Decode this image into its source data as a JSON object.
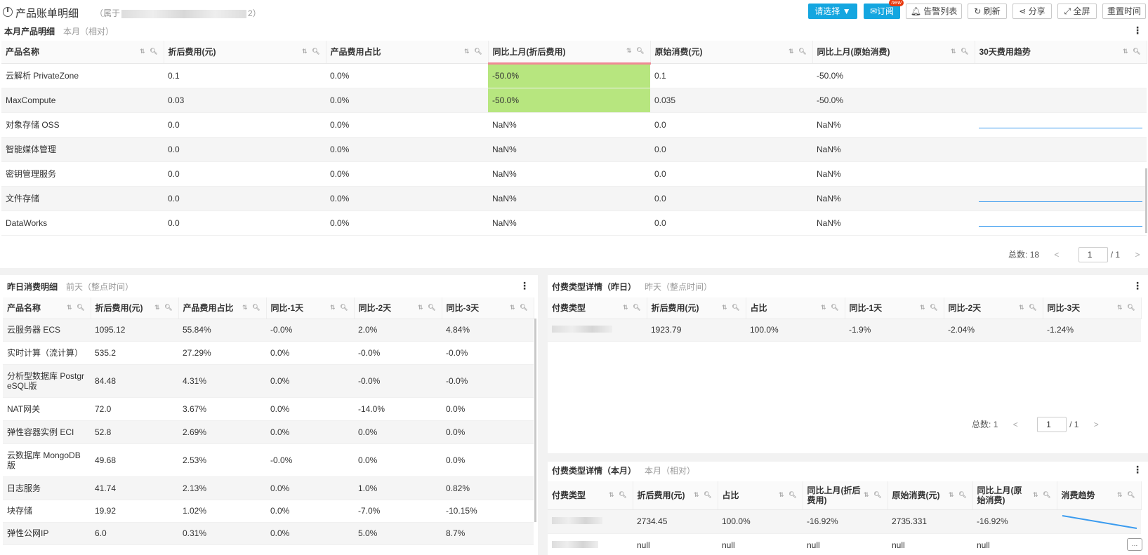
{
  "header": {
    "title": "产品账单明细",
    "owner_prefix": "（属于",
    "owner_suffix": "2）",
    "buttons": {
      "select": "请选择",
      "subscribe": "订阅",
      "new_badge": "new",
      "alerts": "告警列表",
      "refresh": "刷新",
      "share": "分享",
      "fullscreen": "全屏",
      "reset_time": "重置时间"
    }
  },
  "monthly": {
    "title": "本月产品明细",
    "subtitle": "本月（相对）",
    "columns": [
      "产品名称",
      "折后费用(元)",
      "产品费用占比",
      "同比上月(折后费用)",
      "原始消费(元)",
      "同比上月(原始消费)",
      "30天费用趋势"
    ],
    "rows": [
      {
        "name": "云解析 PrivateZone",
        "cost": "0.1",
        "share": "0.0%",
        "mom": "-50.0%",
        "raw": "0.1",
        "raw_mom": "-50.0%",
        "trend": false
      },
      {
        "name": "MaxCompute",
        "cost": "0.03",
        "share": "0.0%",
        "mom": "-50.0%",
        "raw": "0.035",
        "raw_mom": "-50.0%",
        "trend": false
      },
      {
        "name": "对象存储 OSS",
        "cost": "0.0",
        "share": "0.0%",
        "mom": "NaN%",
        "raw": "0.0",
        "raw_mom": "NaN%",
        "trend": true
      },
      {
        "name": "智能媒体管理",
        "cost": "0.0",
        "share": "0.0%",
        "mom": "NaN%",
        "raw": "0.0",
        "raw_mom": "NaN%",
        "trend": false
      },
      {
        "name": "密钥管理服务",
        "cost": "0.0",
        "share": "0.0%",
        "mom": "NaN%",
        "raw": "0.0",
        "raw_mom": "NaN%",
        "trend": false
      },
      {
        "name": "文件存储",
        "cost": "0.0",
        "share": "0.0%",
        "mom": "NaN%",
        "raw": "0.0",
        "raw_mom": "NaN%",
        "trend": true
      },
      {
        "name": "DataWorks",
        "cost": "0.0",
        "share": "0.0%",
        "mom": "NaN%",
        "raw": "0.0",
        "raw_mom": "NaN%",
        "trend": true
      }
    ],
    "pager": {
      "total_label": "总数:",
      "total": "18",
      "page": "1",
      "of": "/ 1",
      "prev": "<",
      "next": ">"
    }
  },
  "yesterday": {
    "title": "昨日消费明细",
    "subtitle": "前天（整点时间）",
    "columns": [
      "产品名称",
      "折后费用(元)",
      "产品费用占比",
      "同比-1天",
      "同比-2天",
      "同比-3天"
    ],
    "rows": [
      {
        "name": "云服务器 ECS",
        "cost": "1095.12",
        "share": "55.84%",
        "d1": "-0.0%",
        "d2": "2.0%",
        "d3": "4.84%"
      },
      {
        "name": "实时计算（流计算）",
        "cost": "535.2",
        "share": "27.29%",
        "d1": "0.0%",
        "d2": "-0.0%",
        "d3": "-0.0%"
      },
      {
        "name": "分析型数据库 PostgreSQL版",
        "cost": "84.48",
        "share": "4.31%",
        "d1": "0.0%",
        "d2": "-0.0%",
        "d3": "-0.0%"
      },
      {
        "name": "NAT网关",
        "cost": "72.0",
        "share": "3.67%",
        "d1": "0.0%",
        "d2": "-14.0%",
        "d3": "0.0%"
      },
      {
        "name": "弹性容器实例 ECI",
        "cost": "52.8",
        "share": "2.69%",
        "d1": "0.0%",
        "d2": "0.0%",
        "d3": "0.0%"
      },
      {
        "name": "云数据库 MongoDB版",
        "cost": "49.68",
        "share": "2.53%",
        "d1": "-0.0%",
        "d2": "0.0%",
        "d3": "0.0%"
      },
      {
        "name": "日志服务",
        "cost": "41.74",
        "share": "2.13%",
        "d1": "0.0%",
        "d2": "1.0%",
        "d3": "0.82%"
      },
      {
        "name": "块存储",
        "cost": "19.92",
        "share": "1.02%",
        "d1": "0.0%",
        "d2": "-7.0%",
        "d3": "-10.15%"
      },
      {
        "name": "弹性公网IP",
        "cost": "6.0",
        "share": "0.31%",
        "d1": "0.0%",
        "d2": "5.0%",
        "d3": "8.7%"
      }
    ]
  },
  "paytype_day": {
    "title": "付费类型详情（昨日）",
    "subtitle": "昨天（整点时间）",
    "columns": [
      "付费类型",
      "折后费用(元)",
      "占比",
      "同比-1天",
      "同比-2天",
      "同比-3天"
    ],
    "rows": [
      {
        "cost": "1923.79",
        "share": "100.0%",
        "d1": "-1.9%",
        "d2": "-2.04%",
        "d3": "-1.24%"
      }
    ],
    "pager": {
      "total_label": "总数:",
      "total": "1",
      "page": "1",
      "of": "/ 1",
      "prev": "<",
      "next": ">"
    }
  },
  "paytype_month": {
    "title": "付费类型详情（本月）",
    "subtitle": "本月（相对）",
    "columns": [
      "付费类型",
      "折后费用(元)",
      "占比",
      "同比上月(折后费用)",
      "原始消费(元)",
      "同比上月(原始消费)",
      "消费趋势"
    ],
    "rows": [
      {
        "cost": "2734.45",
        "share": "100.0%",
        "mom": "-16.92%",
        "raw": "2735.331",
        "raw_mom": "-16.92%"
      },
      {
        "cost": "null",
        "share": "null",
        "mom": "null",
        "raw": "null",
        "raw_mom": "null"
      }
    ]
  },
  "colors": {
    "accent": "#14a6e0",
    "highlight": "#b7e67f",
    "trend_line": "#3a9bef",
    "new_badge": "#e8390e"
  }
}
